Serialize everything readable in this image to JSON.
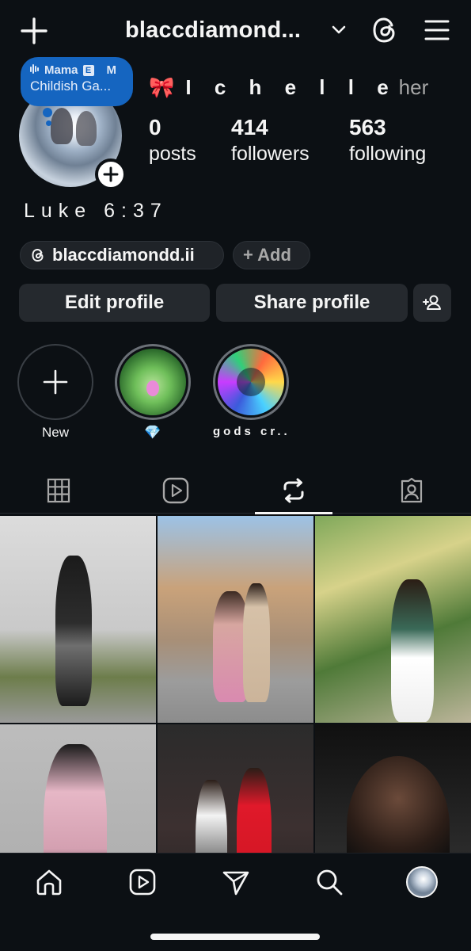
{
  "header": {
    "username": "blaccdiamond...",
    "icons": [
      "plus-icon",
      "chevron-down-icon",
      "threads-icon",
      "menu-icon"
    ]
  },
  "note": {
    "song_title": "Mama",
    "explicit_badge": "E",
    "extra": "M",
    "artist": "Childish Ga...",
    "accent": "#1565c0"
  },
  "profile": {
    "display_emoji": "🎀",
    "display_name": "I c h e l l e",
    "pronouns": "her",
    "stats": [
      {
        "value": "0",
        "label": "posts"
      },
      {
        "value": "414",
        "label": "followers"
      },
      {
        "value": "563",
        "label": "following"
      }
    ],
    "bio": "Luke 6:37",
    "threads_handle": "blaccdiamondd.ii",
    "add_link_label": "+ Add"
  },
  "buttons": {
    "edit_profile": "Edit profile",
    "share_profile": "Share profile"
  },
  "highlights": [
    {
      "label": "New"
    },
    {
      "label": "💎"
    },
    {
      "label": "gods cr..."
    }
  ],
  "tabs": [
    "grid-icon",
    "reels-icon",
    "reposts-icon",
    "tagged-icon"
  ],
  "active_tab": 2,
  "bottom_nav": [
    "home-icon",
    "reels-icon",
    "send-icon",
    "search-icon",
    "profile-avatar"
  ],
  "colors": {
    "background": "#0c1014",
    "button": "#25292e",
    "text": "#f5f5f5",
    "muted": "#a8a8a8"
  }
}
